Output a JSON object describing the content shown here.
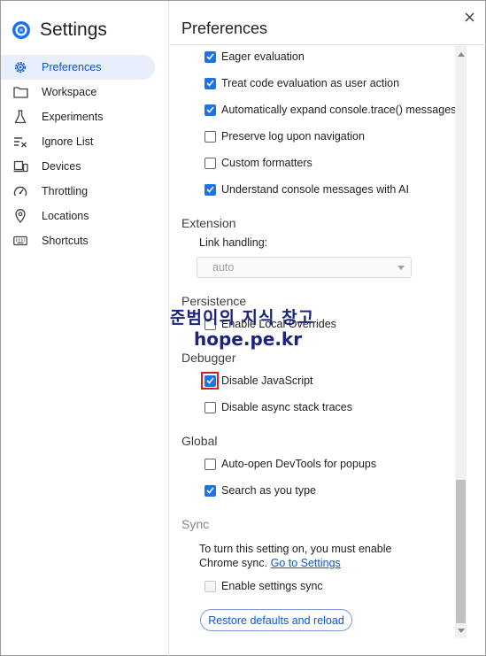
{
  "app": {
    "title": "Settings",
    "logo_icon": "devtools-logo-icon",
    "accent_color": "#1a73e8"
  },
  "sidebar": {
    "items": [
      {
        "label": "Preferences",
        "icon": "gear-icon",
        "active": true
      },
      {
        "label": "Workspace",
        "icon": "folder-icon",
        "active": false
      },
      {
        "label": "Experiments",
        "icon": "flask-icon",
        "active": false
      },
      {
        "label": "Ignore List",
        "icon": "ignore-list-icon",
        "active": false
      },
      {
        "label": "Devices",
        "icon": "devices-icon",
        "active": false
      },
      {
        "label": "Throttling",
        "icon": "speedometer-icon",
        "active": false
      },
      {
        "label": "Locations",
        "icon": "location-pin-icon",
        "active": false
      },
      {
        "label": "Shortcuts",
        "icon": "keyboard-icon",
        "active": false
      }
    ]
  },
  "main": {
    "title": "Preferences",
    "close_icon": "close-icon",
    "console_options": [
      {
        "label": "Eager evaluation",
        "checked": true
      },
      {
        "label": "Treat code evaluation as user action",
        "checked": true
      },
      {
        "label": "Automatically expand console.trace() messages",
        "checked": true
      },
      {
        "label": "Preserve log upon navigation",
        "checked": false
      },
      {
        "label": "Custom formatters",
        "checked": false
      },
      {
        "label": "Understand console messages with AI",
        "checked": true
      }
    ],
    "extension": {
      "heading": "Extension",
      "link_handling_label": "Link handling:",
      "link_handling_value": "auto"
    },
    "persistence": {
      "heading": "Persistence",
      "options": [
        {
          "label": "Enable Local Overrides",
          "checked": false
        }
      ]
    },
    "debugger": {
      "heading": "Debugger",
      "options": [
        {
          "label": "Disable JavaScript",
          "checked": true,
          "highlighted": true
        },
        {
          "label": "Disable async stack traces",
          "checked": false
        }
      ]
    },
    "global": {
      "heading": "Global",
      "options": [
        {
          "label": "Auto-open DevTools for popups",
          "checked": false
        },
        {
          "label": "Search as you type",
          "checked": true
        }
      ]
    },
    "sync": {
      "heading": "Sync",
      "text_line1": "To turn this setting on, you must enable",
      "text_line2": "Chrome sync.",
      "link": "Go to Settings",
      "option": {
        "label": "Enable settings sync",
        "checked": false,
        "disabled": true
      }
    },
    "restore_button": "Restore defaults and reload"
  },
  "watermark": {
    "line1": "준범이의 지식 창고",
    "line2": "hope.pe.kr",
    "color": "#1a237e"
  }
}
